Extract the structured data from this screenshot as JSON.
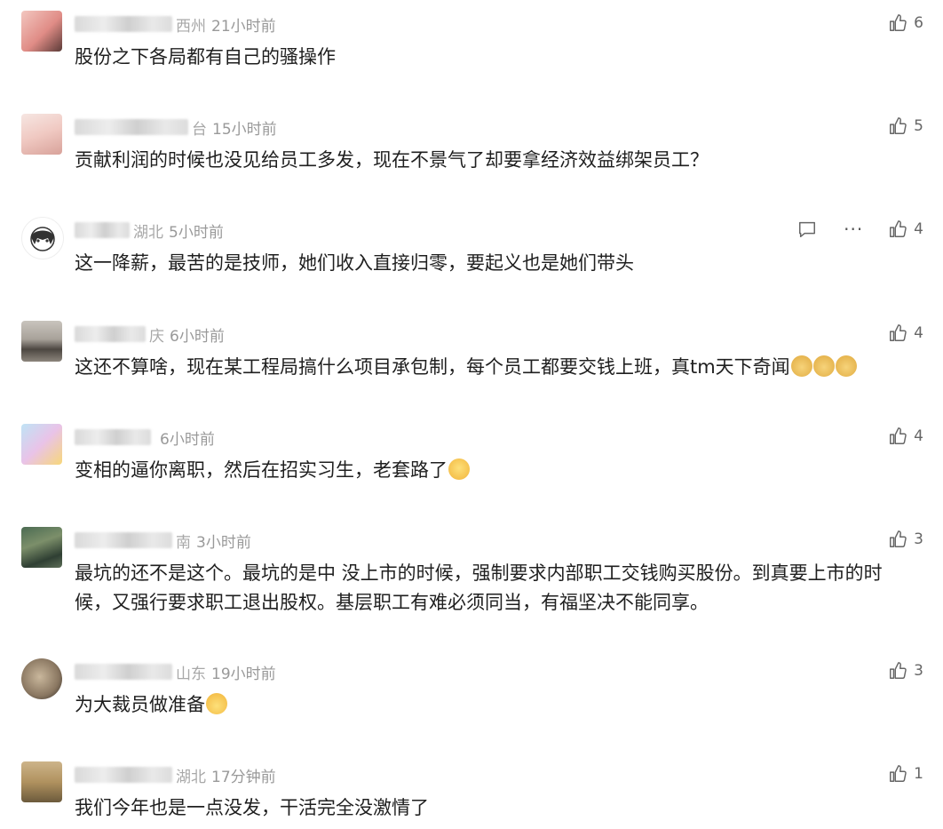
{
  "comments": [
    {
      "location": "西州",
      "time": "21小时前",
      "text": "股份之下各局都有自己的骚操作",
      "likes": "6"
    },
    {
      "location": "台",
      "time": "15小时前",
      "text": "贡献利润的时候也没见给员工多发，现在不景气了却要拿经济效益绑架员工？",
      "likes": "5"
    },
    {
      "location": "湖北",
      "time": "5小时前",
      "text": "这一降薪，最苦的是技师，她们收入直接归零，要起义也是她们带头",
      "likes": "4"
    },
    {
      "location": "庆",
      "time": "6小时前",
      "text": "这还不算啥，现在某工程局搞什么项目承包制，每个员工都要交钱上班，真tm天下奇闻",
      "likes": "4"
    },
    {
      "location": "",
      "time": "6小时前",
      "text": "变相的逼你离职，然后在招实习生，老套路了",
      "likes": "4"
    },
    {
      "location": "南",
      "time": "3小时前",
      "text": "最坑的还不是这个。最坑的是中 没上市的时候，强制要求内部职工交钱购买股份。到真要上市的时候，又强行要求职工退出股权。基层职工有难必须同当，有福坚决不能同享。",
      "likes": "3"
    },
    {
      "location": "山东",
      "time": "19小时前",
      "text": "为大裁员做准备",
      "likes": "3"
    },
    {
      "location": "湖北",
      "time": "17分钟前",
      "text": "我们今年也是一点没发，干活完全没激情了",
      "likes": "1"
    }
  ],
  "icons": {
    "like": "thumbs-up-icon",
    "reply": "comment-icon",
    "more": "more-dots-icon"
  },
  "colors": {
    "meta": "#999999",
    "text": "#1f1f1f",
    "icon": "#666666"
  }
}
